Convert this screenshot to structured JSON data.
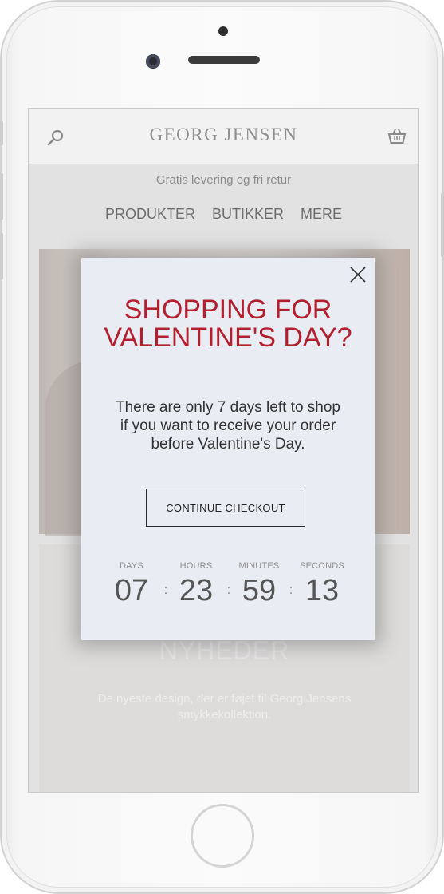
{
  "brand": {
    "logo": "GEORG JENSEN"
  },
  "header": {
    "search_icon": "search-icon",
    "cart_icon": "basket-icon"
  },
  "promo": {
    "text": "Gratis levering og fri retur"
  },
  "nav": {
    "items": [
      "PRODUKTER",
      "BUTIKKER",
      "MERE"
    ]
  },
  "news": {
    "title": "NYHEDER",
    "text": "De nyeste design, der er føjet til Georg Jensens smykkekollektion."
  },
  "modal": {
    "title_line1": "SHOPPING FOR",
    "title_line2": "VALENTINE'S DAY?",
    "body_line1": "There are only 7 days left to shop",
    "body_line2": "if you want to receive your order",
    "body_line3": "before Valentine's Day.",
    "cta_label": "CONTINUE CHECKOUT",
    "close_icon": "close-icon",
    "countdown": {
      "separator": ":",
      "units": [
        {
          "label": "DAYS",
          "value": "07"
        },
        {
          "label": "HOURS",
          "value": "23"
        },
        {
          "label": "MINUTES",
          "value": "59"
        },
        {
          "label": "SECONDS",
          "value": "13"
        }
      ]
    }
  },
  "colors": {
    "accent_title": "#b22030",
    "text_dark": "#333333",
    "header_bg": "#f2f2f2",
    "modal_bg": "#e9ecf2"
  }
}
